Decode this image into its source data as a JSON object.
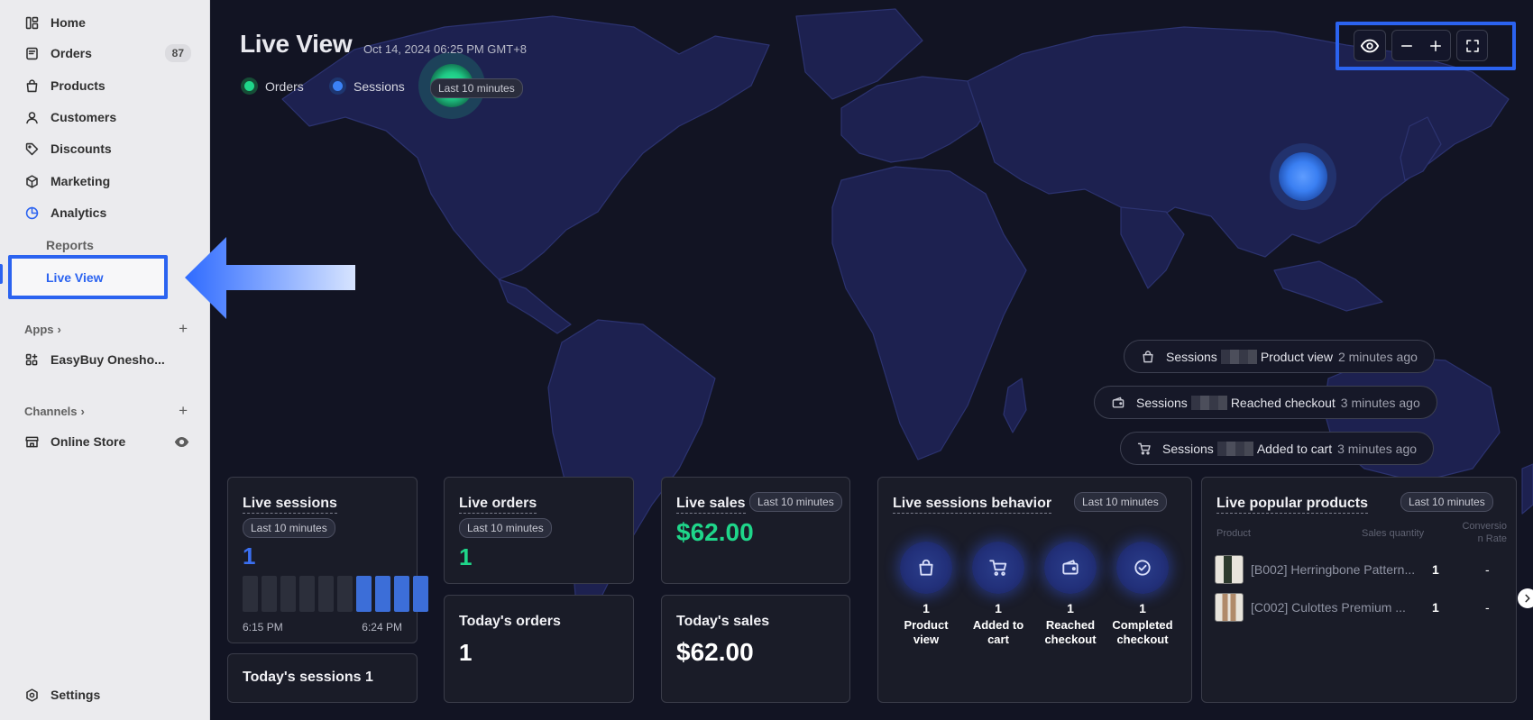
{
  "sidebar": {
    "nav": [
      {
        "label": "Home",
        "icon": "home-icon"
      },
      {
        "label": "Orders",
        "icon": "orders-icon",
        "badge": "87"
      },
      {
        "label": "Products",
        "icon": "products-icon"
      },
      {
        "label": "Customers",
        "icon": "customers-icon"
      },
      {
        "label": "Discounts",
        "icon": "discounts-icon"
      },
      {
        "label": "Marketing",
        "icon": "marketing-icon"
      },
      {
        "label": "Analytics",
        "icon": "analytics-icon"
      }
    ],
    "sub_reports": "Reports",
    "sub_live_view": "Live View",
    "apps_header": "Apps",
    "app_item": "EasyBuy Onesho...",
    "channels_header": "Channels",
    "online_store": "Online Store",
    "settings": "Settings"
  },
  "header": {
    "title": "Live View",
    "date": "Oct 14, 2024 06:25 PM GMT+8",
    "legend_orders": "Orders",
    "legend_sessions": "Sessions",
    "legend_pill": "Last 10 minutes",
    "colors": {
      "orders": "#1fd68a",
      "sessions": "#3b82f6",
      "accent": "#2b63f0"
    }
  },
  "activities": [
    {
      "prefix": "Sessions",
      "action": "Product view",
      "ago": "2 minutes ago",
      "icon": "bag-icon"
    },
    {
      "prefix": "Sessions",
      "action": "Reached checkout",
      "ago": "3 minutes ago",
      "icon": "wallet-icon"
    },
    {
      "prefix": "Sessions",
      "action": "Added to cart",
      "ago": "3 minutes ago",
      "icon": "cart-icon"
    }
  ],
  "live_sessions": {
    "title": "Live sessions",
    "pill": "Last 10 minutes",
    "value": "1",
    "start_label": "6:15 PM",
    "end_label": "6:24 PM",
    "bars": [
      0,
      0,
      0,
      0,
      0,
      0,
      1,
      1,
      1,
      1
    ]
  },
  "today_sessions": {
    "title": "Today's sessions 1"
  },
  "live_orders": {
    "title": "Live orders",
    "pill": "Last 10 minutes",
    "value": "1"
  },
  "today_orders": {
    "title": "Today's orders",
    "value": "1"
  },
  "live_sales": {
    "title": "Live sales",
    "pill": "Last 10 minutes",
    "value": "$62.00"
  },
  "today_sales": {
    "title": "Today's sales",
    "value": "$62.00"
  },
  "behavior": {
    "title": "Live sessions behavior",
    "pill": "Last 10 minutes",
    "items": [
      {
        "value": "1",
        "label1": "Product",
        "label2": "view",
        "icon": "bag-icon"
      },
      {
        "value": "1",
        "label1": "Added to",
        "label2": "cart",
        "icon": "cart-icon"
      },
      {
        "value": "1",
        "label1": "Reached",
        "label2": "checkout",
        "icon": "wallet-icon"
      },
      {
        "value": "1",
        "label1": "Completed",
        "label2": "checkout",
        "icon": "check-circle-icon"
      }
    ]
  },
  "popular": {
    "title": "Live popular products",
    "pill": "Last 10 minutes",
    "col_product": "Product",
    "col_qty": "Sales quantity",
    "col_rate1": "Conversio",
    "col_rate2": "n Rate",
    "rows": [
      {
        "name": "[B002] Herringbone Pattern...",
        "qty": "1",
        "rate": "-"
      },
      {
        "name": "[C002] Culottes Premium ...",
        "qty": "1",
        "rate": "-"
      }
    ]
  }
}
